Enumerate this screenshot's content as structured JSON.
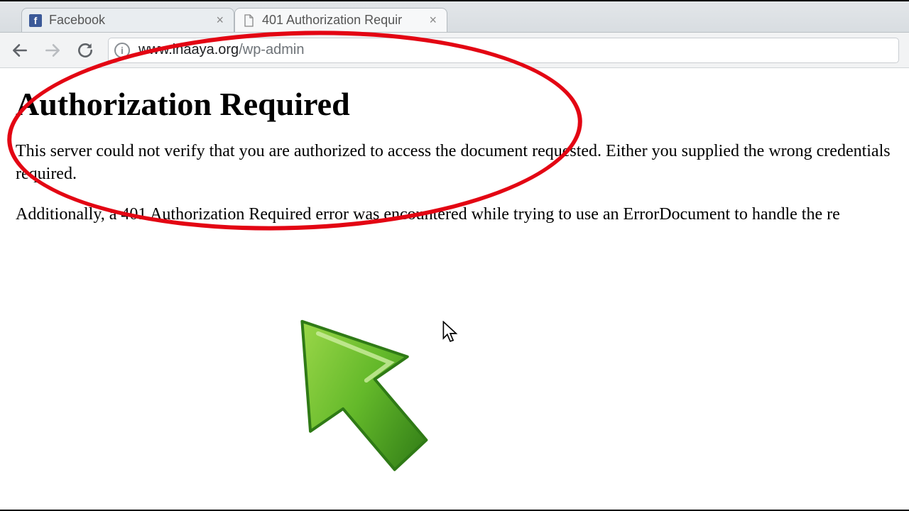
{
  "tabs": [
    {
      "title": "Facebook",
      "active": false,
      "favicon": "facebook"
    },
    {
      "title": "401 Authorization Requir",
      "active": true,
      "favicon": "document"
    }
  ],
  "toolbar": {
    "url_domain": "www.inaaya.org",
    "url_path": "/wp-admin"
  },
  "page": {
    "heading": "Authorization Required",
    "para1": "This server could not verify that you are authorized to access the document requested. Either you supplied the wrong credentials required.",
    "para2": "Additionally, a 401 Authorization Required error was encountered while trying to use an ErrorDocument to handle the re"
  },
  "annotation": {
    "ellipse_color": "#e30513",
    "arrow_color_light": "#7ac142",
    "arrow_color_dark": "#3f8f1e"
  }
}
